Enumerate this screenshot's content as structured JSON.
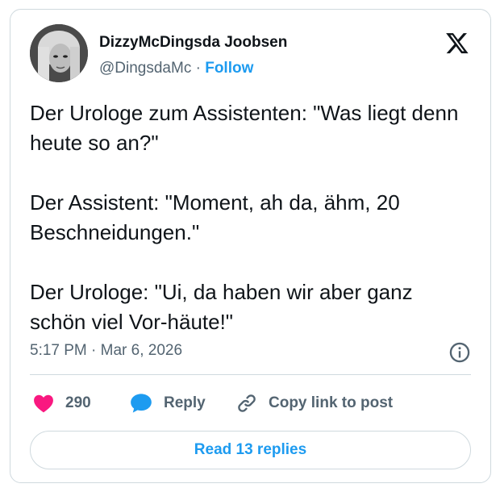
{
  "author": {
    "display_name": "DizzyMcDingsda Joobsen",
    "handle": "@DingsdaMc",
    "separator": " · ",
    "follow_label": "Follow"
  },
  "tweet": {
    "paragraphs": [
      "Der Urologe zum Assistenten: \"Was liegt denn heute so an?\"",
      "Der Assistent: \"Moment, ah da, ähm, 20 Beschneidungen.\"",
      "Der Urologe: \"Ui, da haben wir aber ganz schön viel Vor-häute!\""
    ],
    "time": "5:17 PM · Mar 6, 2026"
  },
  "actions": {
    "like_count": "290",
    "reply_label": "Reply",
    "copy_label": "Copy link to post"
  },
  "footer": {
    "read_replies_label": "Read 13 replies"
  },
  "icons": {
    "like": "heart-icon",
    "reply": "speech-bubble-icon",
    "copy": "link-icon",
    "info": "info-icon",
    "brand": "x-logo-icon"
  },
  "colors": {
    "accent": "#1d9bf0",
    "like": "#f91880",
    "text": "#0f1419",
    "secondary": "#536471",
    "border": "#cfd9de"
  }
}
